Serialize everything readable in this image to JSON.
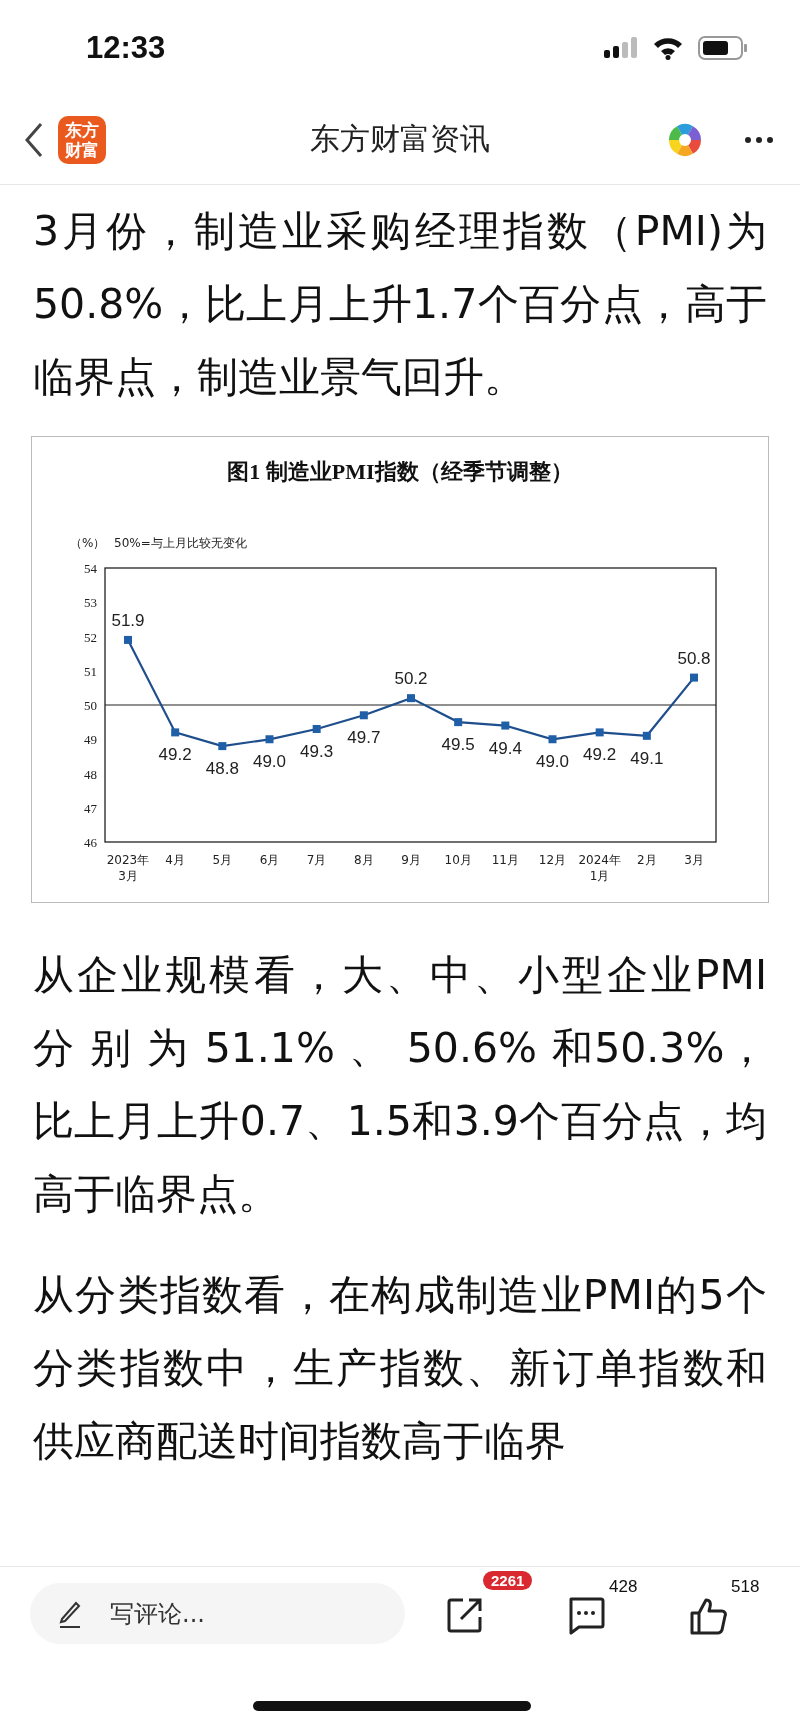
{
  "status_bar": {
    "time": "12:33"
  },
  "nav": {
    "logo_lines": [
      "东方",
      "财富"
    ],
    "title": "东方财富资讯"
  },
  "paragraphs": [
    "3月份，制造业采购经理指数（PMI)为50.8%，比上月上升1.7个百分点，高于临界点，制造业景气回升。"
  ],
  "chart": {
    "chart_data": {
      "type": "line",
      "title": "图1  制造业PMI指数（经季节调整）",
      "ylabel": "（%）",
      "annotations": [
        "50%=与上月比较无变化"
      ],
      "categories": [
        "2023年\n3月",
        "4月",
        "5月",
        "6月",
        "7月",
        "8月",
        "9月",
        "10月",
        "11月",
        "12月",
        "2024年\n1月",
        "2月",
        "3月"
      ],
      "values": [
        51.9,
        49.2,
        48.8,
        49.0,
        49.3,
        49.7,
        50.2,
        49.5,
        49.4,
        49.0,
        49.2,
        49.1,
        50.8
      ],
      "value_labels": [
        "51.9",
        "49.2",
        "48.8",
        "49.0",
        "49.3",
        "49.7",
        "50.2",
        "49.5",
        "49.4",
        "49.0",
        "49.2",
        "49.1",
        "50.8"
      ],
      "marker": "square",
      "ylim": [
        46,
        54
      ],
      "yticks": [
        46,
        47,
        48,
        49,
        50,
        51,
        52,
        53,
        54
      ],
      "data_labels": true
    }
  },
  "paragraphs_after": [
    "从企业规模看，大、中、小型企业PMI 分 别 为 51.1% 、 50.6% 和50.3%，比上月上升0.7、1.5和3.9个百分点，均高于临界点。",
    "从分类指数看，在构成制造业PMI的5个分类指数中，生产指数、新订单指数和供应商配送时间指数高于临界"
  ],
  "bottom_bar": {
    "comment_placeholder": "写评论...",
    "share_count": "2261",
    "comment_count": "428",
    "like_count": "518"
  }
}
